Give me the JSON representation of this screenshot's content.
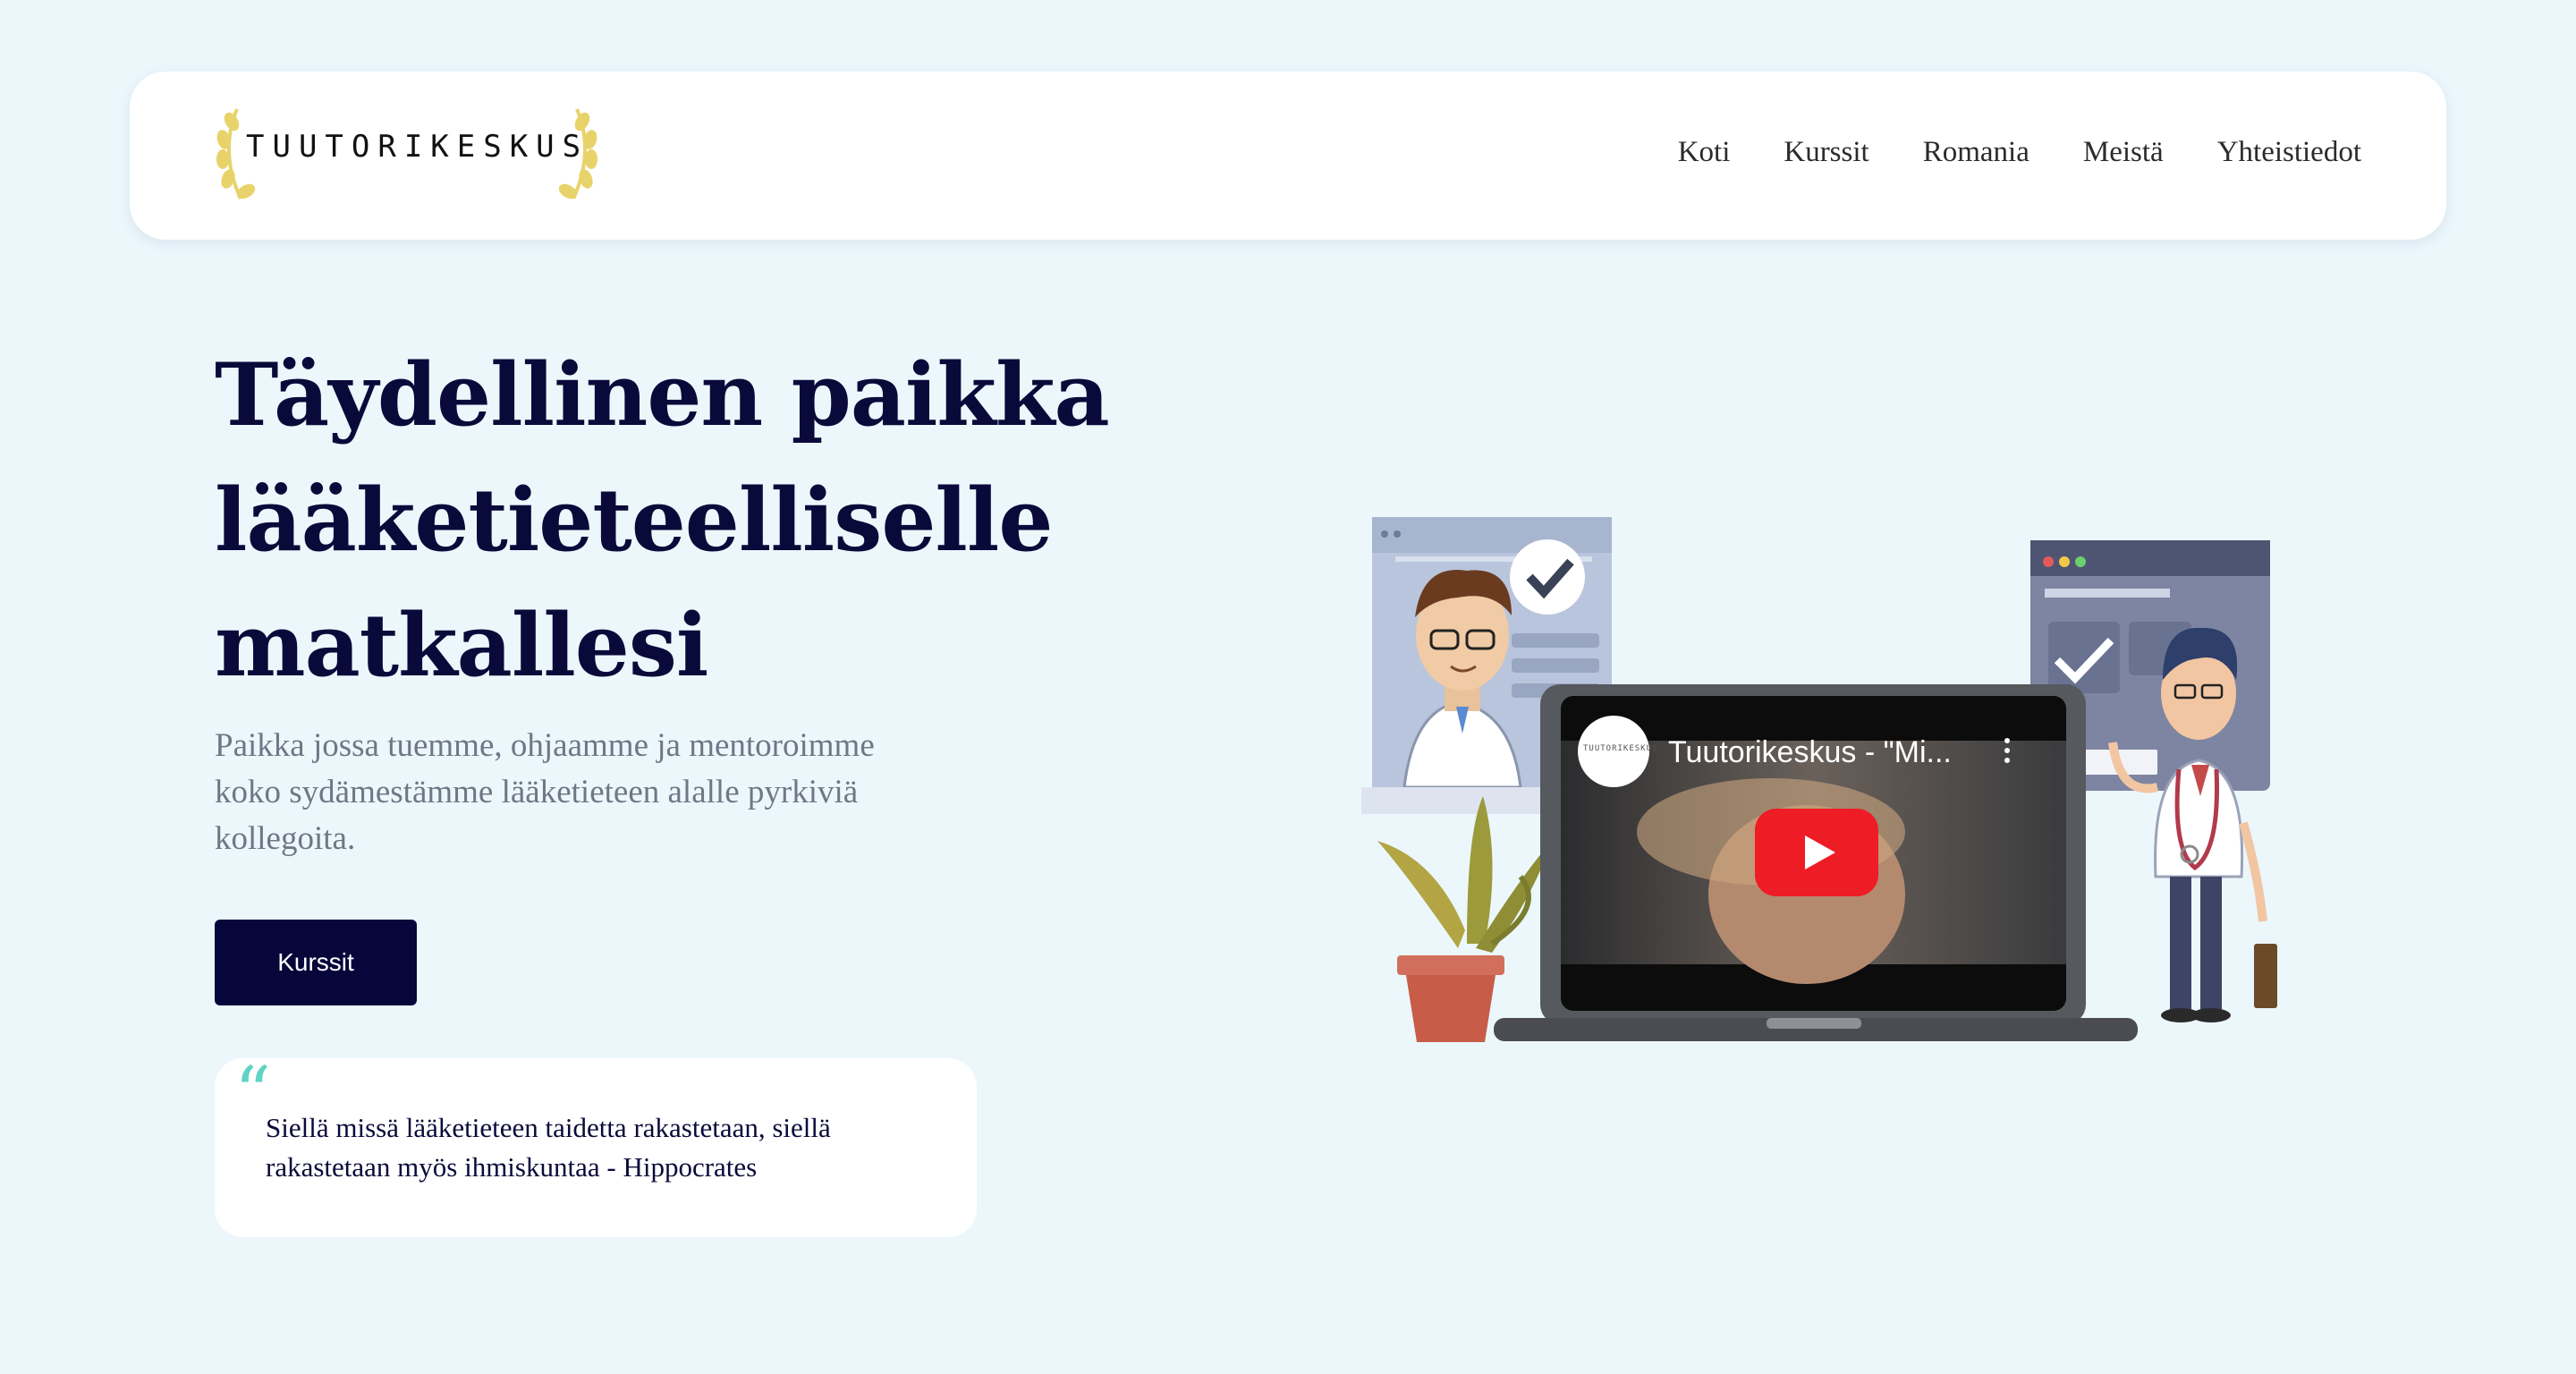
{
  "header": {
    "logo_text": "TUUTORIKESKUS",
    "nav": [
      "Koti",
      "Kurssit",
      "Romania",
      "Meistä",
      "Yhteistiedot"
    ]
  },
  "hero": {
    "title": "Täydellinen paikka lääketieteelliselle matkallesi",
    "subtitle": "Paikka jossa tuemme, ohjaamme ja mentoroimme koko sydämestämme lääketieteen alalle pyrkiviä kollegoita.",
    "cta_label": "Kurssit"
  },
  "quote": {
    "mark": "“",
    "text": "Siellä missä lääketieteen taidetta rakastetaan, siellä rakastetaan myös ihmiskuntaa - Hippocrates"
  },
  "video": {
    "title": "Tuutorikeskus - \"Mi...",
    "channel_logo_text": "TUUTORIKESKUS"
  },
  "colors": {
    "background": "#ecf7fc",
    "title": "#0a0a3a",
    "cta_bg": "#07063a",
    "quote_accent": "#5fd3c6",
    "play_red": "#ee1c24",
    "laurel": "#e8d36a"
  },
  "icons": [
    "laurel-icon",
    "check-icon",
    "play-icon",
    "kebab-menu-icon"
  ]
}
